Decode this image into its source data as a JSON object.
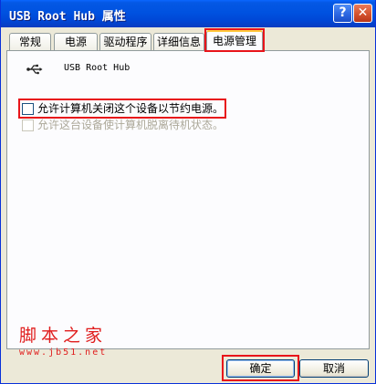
{
  "window": {
    "title": "USB Root Hub 属性",
    "help_glyph": "?",
    "close_glyph": "✕"
  },
  "tabs": [
    {
      "label": "常规"
    },
    {
      "label": "电源"
    },
    {
      "label": "驱动程序"
    },
    {
      "label": "详细信息"
    },
    {
      "label": "电源管理",
      "active": true
    }
  ],
  "device": {
    "icon": "usb-icon",
    "name": "USB Root Hub"
  },
  "options": [
    {
      "label": "允许计算机关闭这个设备以节约电源。",
      "checked": false,
      "enabled": true
    },
    {
      "label": "允许这台设备使计算机脱离待机状态。",
      "checked": false,
      "enabled": false
    }
  ],
  "watermark": {
    "site_name": "脚本之家",
    "url": "www.jb51.net"
  },
  "buttons": {
    "ok": "确定",
    "cancel": "取消"
  },
  "colors": {
    "title_bar": "#0052e0",
    "dialog_bg": "#ece9d8",
    "highlight": "#e8141a",
    "watermark": "#e01d1d"
  }
}
